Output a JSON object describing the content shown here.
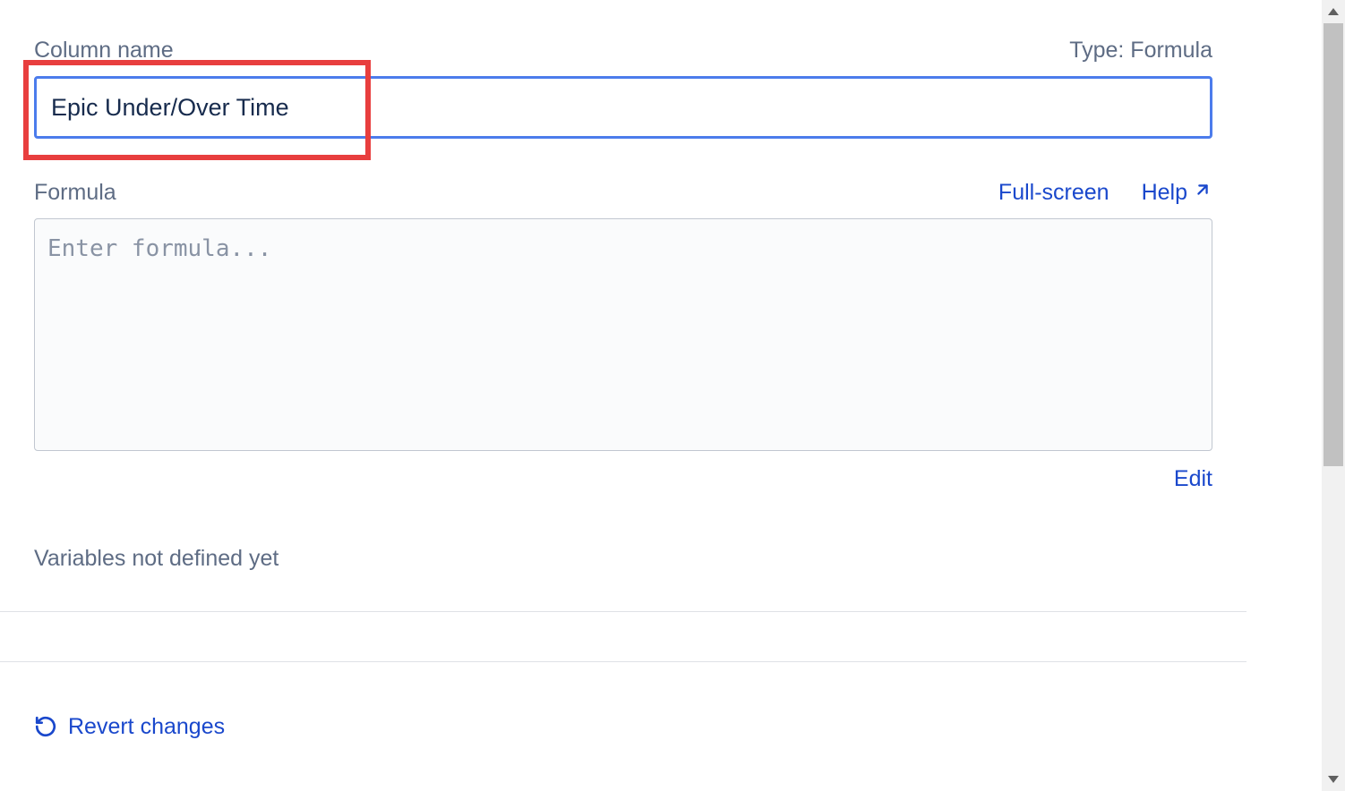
{
  "header": {
    "column_name_label": "Column name",
    "type_label": "Type: Formula"
  },
  "column_name_input": {
    "value": "Epic Under/Over Time"
  },
  "formula_section": {
    "label": "Formula",
    "fullscreen_link": "Full-screen",
    "help_link": "Help",
    "placeholder": "Enter formula...",
    "value": "",
    "edit_link": "Edit"
  },
  "variables": {
    "text": "Variables not defined yet"
  },
  "footer": {
    "revert_label": "Revert changes"
  }
}
